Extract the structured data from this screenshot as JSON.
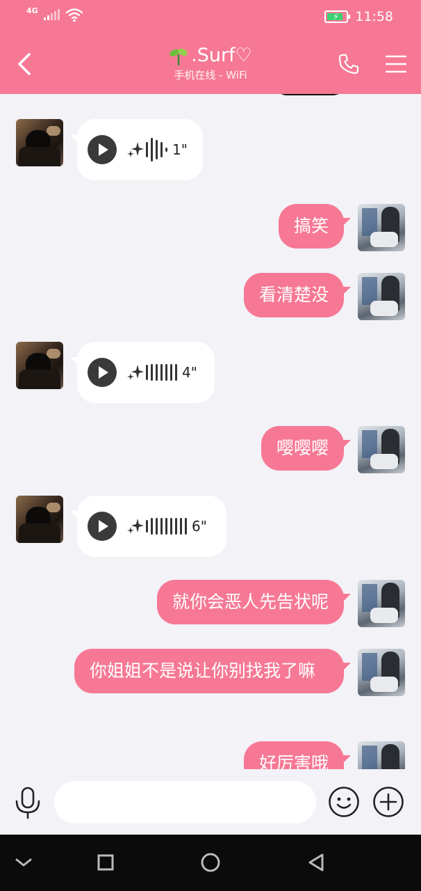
{
  "status_bar": {
    "network": "4G",
    "time": "11:58",
    "battery_level": 0.75,
    "signal_bars_on": 2
  },
  "header": {
    "title": ".Surf♡",
    "subtitle": "手机在线 - WiFi"
  },
  "messages": [
    {
      "direction": "in",
      "type": "voice",
      "duration": "1\""
    },
    {
      "direction": "out",
      "type": "text",
      "text": "搞笑"
    },
    {
      "direction": "out",
      "type": "text",
      "text": "看清楚没"
    },
    {
      "direction": "in",
      "type": "voice",
      "duration": "4\""
    },
    {
      "direction": "out",
      "type": "text",
      "text": "嘤嘤嘤"
    },
    {
      "direction": "in",
      "type": "voice",
      "duration": "6\""
    },
    {
      "direction": "out",
      "type": "text",
      "text": "就你会恶人先告状呢"
    },
    {
      "direction": "out",
      "type": "text",
      "text": "你姐姐不是说让你别找我了嘛"
    },
    {
      "direction": "out",
      "type": "text",
      "text": "好厉害哦"
    }
  ],
  "input": {
    "value": "",
    "placeholder": ""
  },
  "colors": {
    "accent": "#f67895",
    "background": "#f2f2f7",
    "incoming_bubble": "#ffffff",
    "nav_bar": "#0b0b0b"
  },
  "icons": {
    "back": "chevron-left-icon",
    "call": "phone-icon",
    "menu": "hamburger-menu-icon",
    "play": "play-icon",
    "sparkle": "sparkle-icon",
    "mic": "microphone-icon",
    "emoji": "smiley-icon",
    "plus": "plus-circle-icon",
    "sys_down": "chevron-down-icon",
    "sys_recent": "square-icon",
    "sys_home": "circle-icon",
    "sys_back": "triangle-back-icon"
  }
}
